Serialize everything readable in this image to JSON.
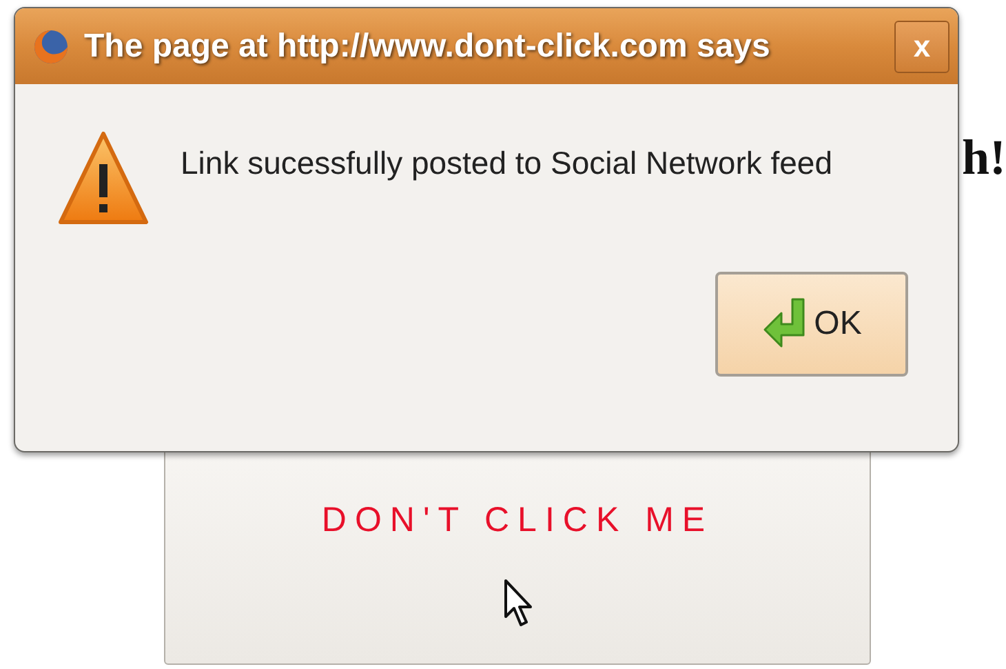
{
  "page": {
    "heading": "h!",
    "button": "DON'T CLICK ME"
  },
  "dialog": {
    "title": "The page at http://www.dont-click.com says",
    "close": "x",
    "message": "Link sucessfully posted to Social Network feed",
    "ok_button": "OK"
  }
}
